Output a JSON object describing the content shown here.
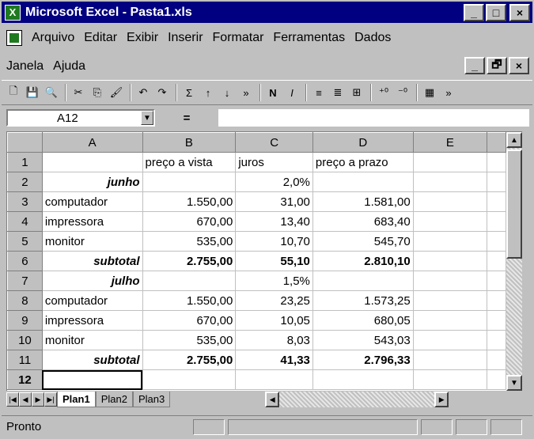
{
  "window": {
    "title": "Microsoft Excel - Pasta1.xls",
    "app_icon": "excel-icon",
    "buttons": [
      "_",
      "□",
      "×"
    ]
  },
  "menu": {
    "items": [
      "Arquivo",
      "Editar",
      "Exibir",
      "Inserir",
      "Formatar",
      "Ferramentas",
      "Dados",
      "Janela",
      "Ajuda"
    ],
    "mdi_buttons": [
      "_",
      "🗗",
      "×"
    ]
  },
  "formula_bar": {
    "cell_ref": "A12",
    "equals": "=",
    "value": ""
  },
  "grid": {
    "columns": [
      "A",
      "B",
      "C",
      "D",
      "E"
    ],
    "rows": [
      {
        "n": "1",
        "cells": [
          "",
          "preço a vista",
          "juros",
          "preço a prazo",
          ""
        ]
      },
      {
        "n": "2",
        "cells": [
          "junho",
          "",
          "2,0%",
          "",
          ""
        ]
      },
      {
        "n": "3",
        "cells": [
          "computador",
          "1.550,00",
          "31,00",
          "1.581,00",
          ""
        ]
      },
      {
        "n": "4",
        "cells": [
          "impressora",
          "670,00",
          "13,40",
          "683,40",
          ""
        ]
      },
      {
        "n": "5",
        "cells": [
          "monitor",
          "535,00",
          "10,70",
          "545,70",
          ""
        ]
      },
      {
        "n": "6",
        "cells": [
          "subtotal",
          "2.755,00",
          "55,10",
          "2.810,10",
          ""
        ]
      },
      {
        "n": "7",
        "cells": [
          "julho",
          "",
          "1,5%",
          "",
          ""
        ]
      },
      {
        "n": "8",
        "cells": [
          "computador",
          "1.550,00",
          "23,25",
          "1.573,25",
          ""
        ]
      },
      {
        "n": "9",
        "cells": [
          "impressora",
          "670,00",
          "10,05",
          "680,05",
          ""
        ]
      },
      {
        "n": "10",
        "cells": [
          "monitor",
          "535,00",
          "8,03",
          "543,03",
          ""
        ]
      },
      {
        "n": "11",
        "cells": [
          "subtotal",
          "2.755,00",
          "41,33",
          "2.796,33",
          ""
        ]
      },
      {
        "n": "12",
        "cells": [
          "",
          "",
          "",
          "",
          ""
        ]
      }
    ]
  },
  "sheets": {
    "tabs": [
      "Plan1",
      "Plan2",
      "Plan3"
    ],
    "active": "Plan1"
  },
  "status": {
    "text": "Pronto"
  }
}
